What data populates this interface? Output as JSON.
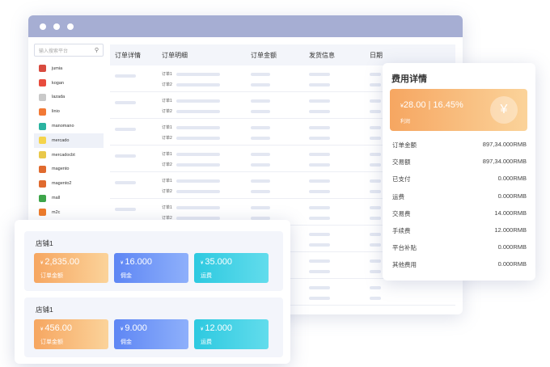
{
  "window": {
    "search_placeholder": "输入搜索平台"
  },
  "platforms": [
    "jumia",
    "kogan",
    "lazada",
    "linio",
    "manomano",
    "mercado",
    "mercadocbt",
    "magento",
    "magento2",
    "mall",
    "m2c",
    "",
    "",
    ""
  ],
  "platform_colors": [
    "#d84b3f",
    "#e84c3d",
    "#c9c9c9",
    "#f27935",
    "#2bb3a0",
    "#f5d44b",
    "#e9c84a",
    "#e06a2e",
    "#e06a2e",
    "#3da54a",
    "#ef7a28",
    "#bbbbbb",
    "#bbbbbb",
    "#bbbbbb"
  ],
  "table": {
    "headers": [
      "订单详情",
      "订单明细",
      "订单金额",
      "发货信息",
      "日期"
    ],
    "order_line_1": "订单1",
    "order_line_2": "订单2"
  },
  "fee_panel": {
    "title": "费用详情",
    "currency": "¥",
    "profit_amount": "28.00",
    "profit_rate": "16.45%",
    "profit_label": "利润",
    "rows": [
      {
        "label": "订单金额",
        "value": "897,34.000RMB"
      },
      {
        "label": "交易额",
        "value": "897,34.000RMB"
      },
      {
        "label": "已支付",
        "value": "0.000RMB"
      },
      {
        "label": "运费",
        "value": "0.000RMB"
      },
      {
        "label": "交易费",
        "value": "14.000RMB"
      },
      {
        "label": "手续费",
        "value": "12.000RMB"
      },
      {
        "label": "平台补贴",
        "value": "0.000RMB"
      },
      {
        "label": "其他费用",
        "value": "0.000RMB"
      }
    ]
  },
  "shops": [
    {
      "name": "店铺1",
      "cards": [
        {
          "currency": "¥",
          "amount": "2,835.00",
          "label": "订单金额"
        },
        {
          "currency": "¥",
          "amount": "16.000",
          "label": "佣金"
        },
        {
          "currency": "¥",
          "amount": "35.000",
          "label": "运费"
        }
      ]
    },
    {
      "name": "店铺1",
      "cards": [
        {
          "currency": "¥",
          "amount": "456.00",
          "label": "订单金额"
        },
        {
          "currency": "¥",
          "amount": "9.000",
          "label": "佣金"
        },
        {
          "currency": "¥",
          "amount": "12.000",
          "label": "运费"
        }
      ]
    }
  ]
}
